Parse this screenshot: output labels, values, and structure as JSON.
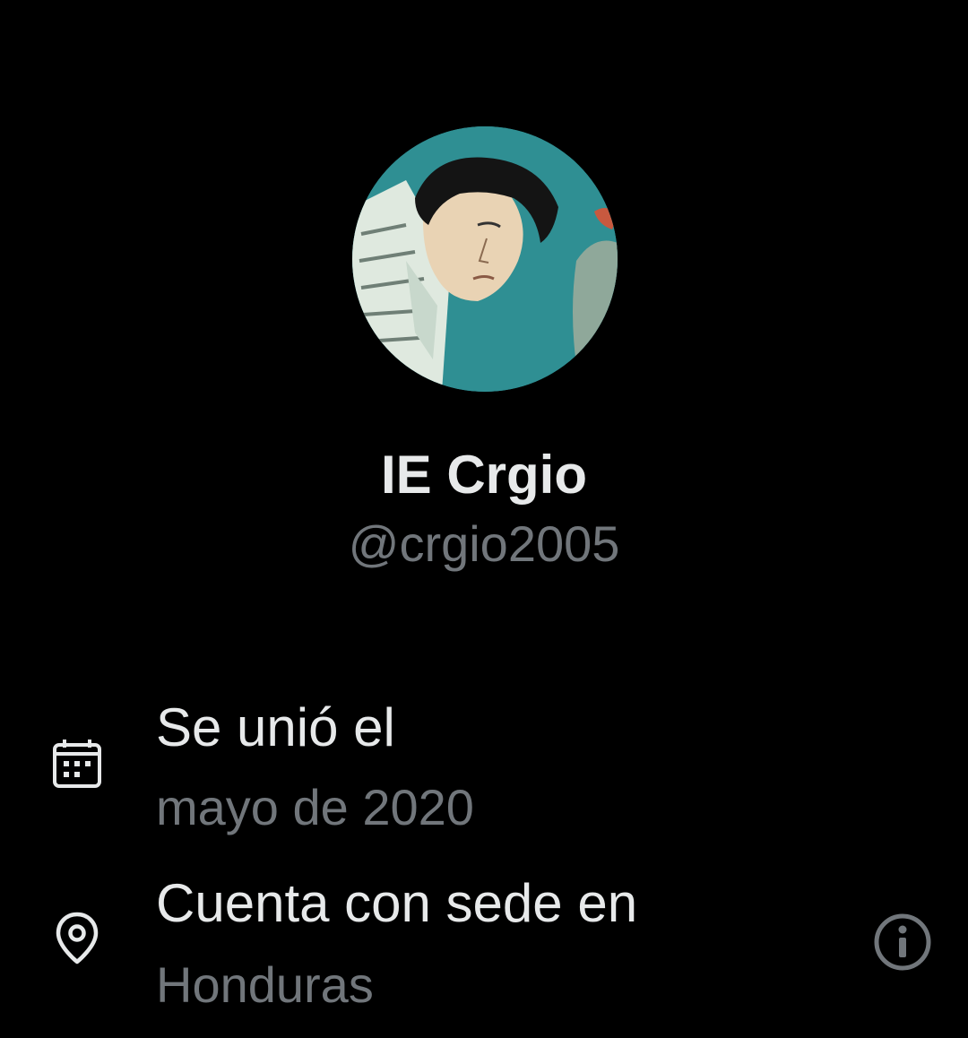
{
  "profile": {
    "display_name": "IE Crgio",
    "handle": "@crgio2005",
    "avatar_icon": "profile-photo-avatar",
    "avatar_bg_color": "#2f8f93"
  },
  "details": {
    "joined": {
      "icon": "calendar-icon",
      "label": "Se unió el",
      "value": "mayo de 2020"
    },
    "location": {
      "icon": "location-pin-icon",
      "label": "Cuenta con sede en",
      "value": "Honduras",
      "info_icon": "info-icon"
    }
  },
  "colors": {
    "background": "#000000",
    "primary_text": "#e7e9ea",
    "secondary_text": "#71767b"
  }
}
